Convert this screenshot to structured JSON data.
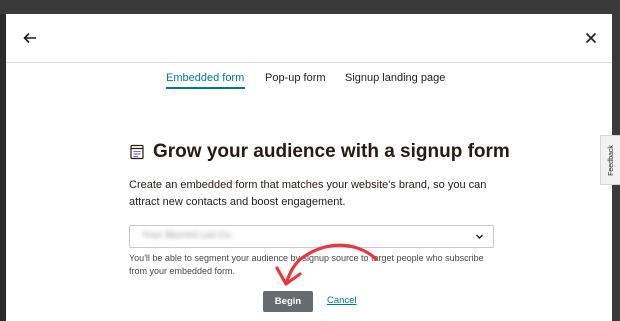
{
  "header": {
    "back_icon": "arrow-left-icon",
    "close_icon": "close-icon"
  },
  "tabs": [
    {
      "label": "Embedded form",
      "active": true
    },
    {
      "label": "Pop-up form",
      "active": false
    },
    {
      "label": "Signup landing page",
      "active": false
    }
  ],
  "main": {
    "title_icon": "form-document-icon",
    "title": "Grow your audience with a signup form",
    "description": "Create an embedded form that matches your website's brand, so you can attract new contacts and boost engagement.",
    "audience_select": {
      "value": "Your Blurred List Co",
      "chevron_icon": "chevron-down-icon"
    },
    "helper_text": "You'll be able to segment your audience by signup source to target people who subscribe from your embedded form.",
    "begin_label": "Begin",
    "cancel_label": "Cancel"
  },
  "feedback_label": "Feedback",
  "colors": {
    "accent": "#007c89",
    "button_bg": "#666b6f",
    "annotation": "#e8383d",
    "backdrop": "#2b2b2b"
  }
}
